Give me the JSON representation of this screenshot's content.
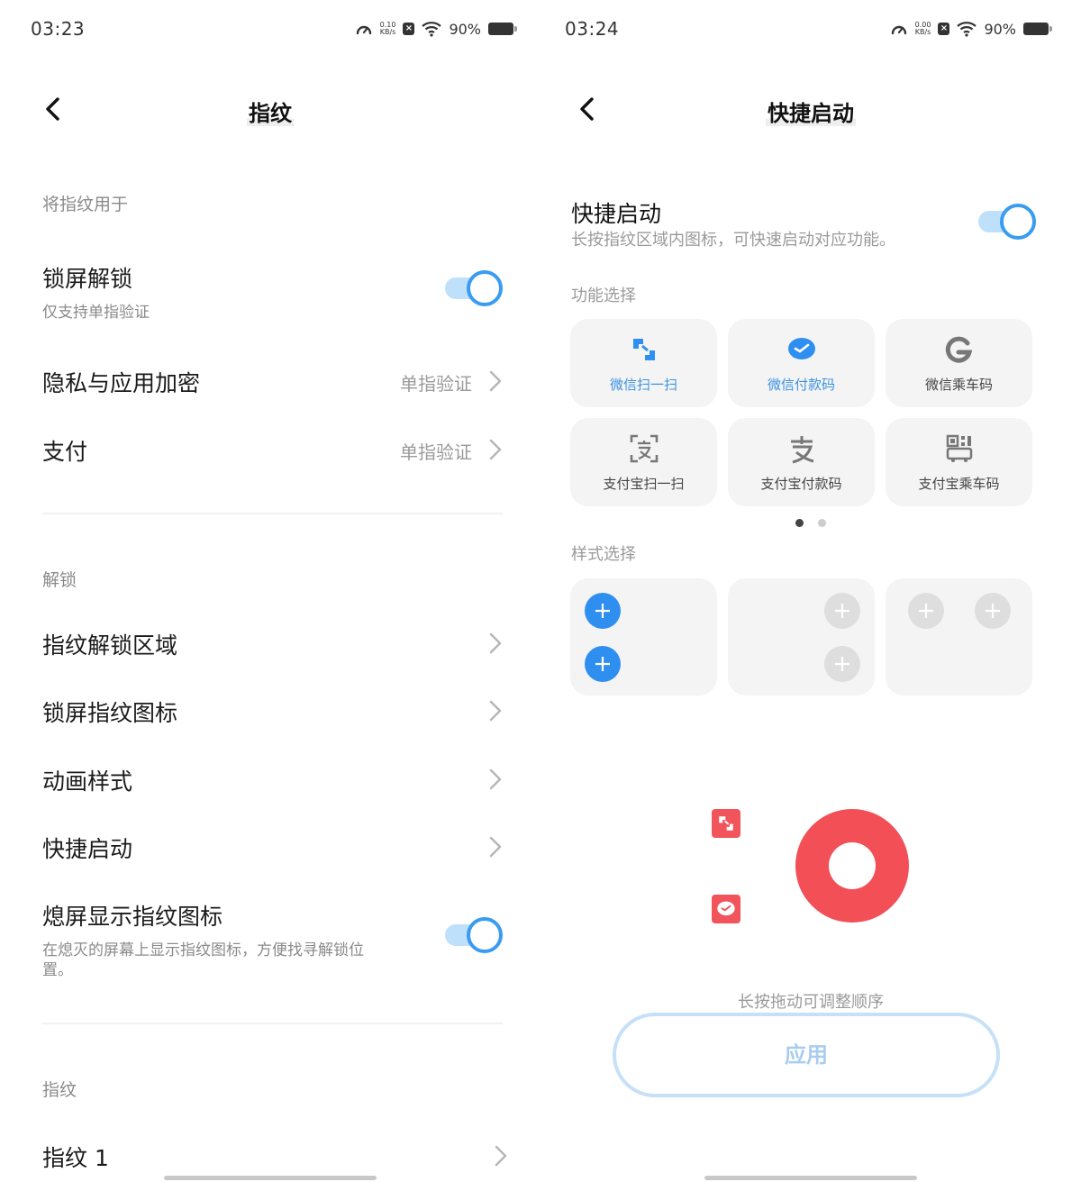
{
  "left": {
    "status": {
      "time": "03:23",
      "speed_value": "0.10",
      "speed_unit": "KB/s",
      "battery": "90%"
    },
    "title": "指纹",
    "sections": {
      "use_for": "将指纹用于",
      "unlock": "解锁",
      "fingerprints": "指纹"
    },
    "rows": {
      "lockscreen": {
        "title": "锁屏解锁",
        "sub": "仅支持单指验证",
        "toggle_on": true
      },
      "privacy": {
        "title": "隐私与应用加密",
        "value": "单指验证"
      },
      "payment": {
        "title": "支付",
        "value": "单指验证"
      },
      "unlock_area": {
        "title": "指纹解锁区域"
      },
      "lock_icon": {
        "title": "锁屏指纹图标"
      },
      "animation": {
        "title": "动画样式"
      },
      "quick_launch": {
        "title": "快捷启动"
      },
      "aod_icon": {
        "title": "熄屏显示指纹图标",
        "sub": "在熄灭的屏幕上显示指纹图标，方便找寻解锁位置。",
        "toggle_on": true
      },
      "fp1": {
        "title": "指纹 1"
      }
    }
  },
  "right": {
    "status": {
      "time": "03:24",
      "speed_value": "0.00",
      "speed_unit": "KB/s",
      "battery": "90%"
    },
    "title": "快捷启动",
    "quick_launch": {
      "title": "快捷启动",
      "desc": "长按指纹区域内图标，可快速启动对应功能。",
      "toggle_on": true
    },
    "function_label": "功能选择",
    "functions": [
      {
        "label": "微信扫一扫",
        "icon": "wechat-scan-icon",
        "selected": true
      },
      {
        "label": "微信付款码",
        "icon": "wechat-pay-icon",
        "selected": true
      },
      {
        "label": "微信乘车码",
        "icon": "wechat-bus-icon",
        "selected": false
      },
      {
        "label": "支付宝扫一扫",
        "icon": "alipay-scan-icon",
        "selected": false
      },
      {
        "label": "支付宝付款码",
        "icon": "alipay-pay-icon",
        "selected": false
      },
      {
        "label": "支付宝乘车码",
        "icon": "alipay-bus-icon",
        "selected": false
      }
    ],
    "page_indicator": {
      "pages": 2,
      "current": 1
    },
    "style_label": "样式选择",
    "hint": "长按拖动可调整顺序",
    "apply_label": "应用",
    "colors": {
      "accent": "#2f8ff0",
      "selected_text": "#3a92e3",
      "fingerprint": "#f24f56"
    }
  }
}
